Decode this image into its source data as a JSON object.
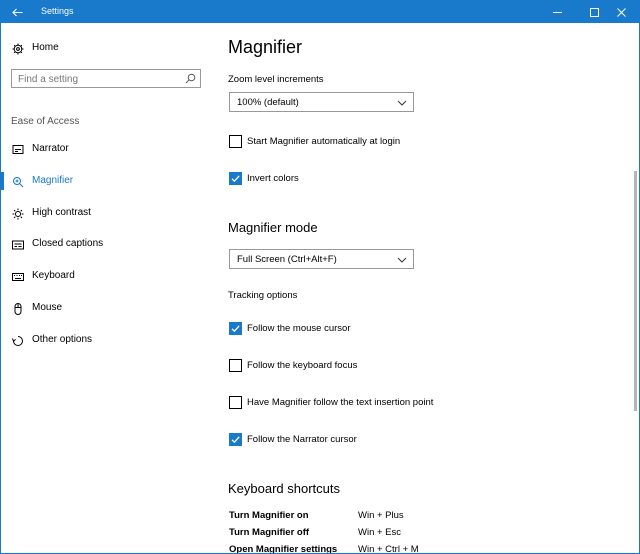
{
  "window": {
    "title": "Settings"
  },
  "sidebar": {
    "home_label": "Home",
    "search_placeholder": "Find a setting",
    "section_label": "Ease of Access",
    "items": [
      {
        "label": "Narrator",
        "icon": "narrator-icon"
      },
      {
        "label": "Magnifier",
        "icon": "magnifier-icon",
        "active": true
      },
      {
        "label": "High contrast",
        "icon": "high-contrast-icon"
      },
      {
        "label": "Closed captions",
        "icon": "closed-captions-icon"
      },
      {
        "label": "Keyboard",
        "icon": "keyboard-icon"
      },
      {
        "label": "Mouse",
        "icon": "mouse-icon"
      },
      {
        "label": "Other options",
        "icon": "other-options-icon"
      }
    ]
  },
  "main": {
    "title": "Magnifier",
    "zoom_label": "Zoom level increments",
    "zoom_value": "100% (default)",
    "start_auto": {
      "label": "Start Magnifier automatically at login",
      "checked": false
    },
    "invert_colors": {
      "label": "Invert colors",
      "checked": true
    },
    "mode_heading": "Magnifier mode",
    "mode_value": "Full Screen (Ctrl+Alt+F)",
    "tracking_label": "Tracking options",
    "tracking": [
      {
        "label": "Follow the mouse cursor",
        "checked": true
      },
      {
        "label": "Follow the keyboard focus",
        "checked": false
      },
      {
        "label": "Have Magnifier follow the text insertion point",
        "checked": false
      },
      {
        "label": "Follow the Narrator cursor",
        "checked": true
      }
    ],
    "shortcuts_heading": "Keyboard shortcuts",
    "shortcuts": [
      {
        "action": "Turn Magnifier on",
        "keys": "Win + Plus"
      },
      {
        "action": "Turn Magnifier off",
        "keys": "Win + Esc"
      },
      {
        "action": "Open Magnifier settings",
        "keys": "Win + Ctrl + M"
      }
    ]
  },
  "colors": {
    "accent": "#1979ca"
  }
}
